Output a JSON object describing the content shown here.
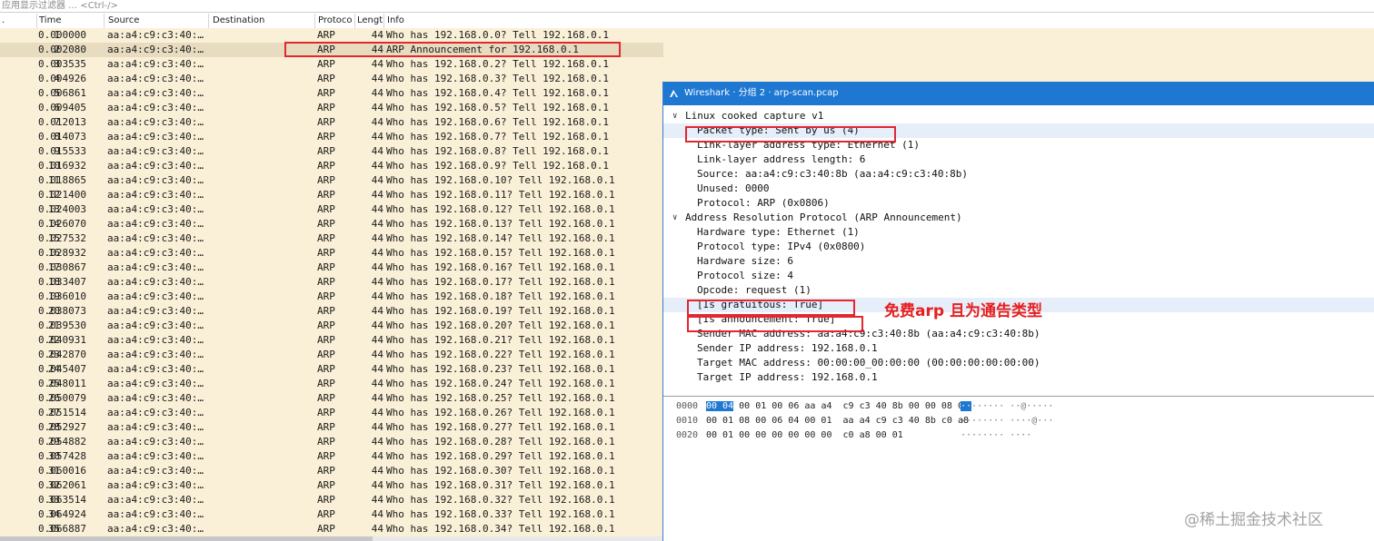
{
  "filter": {
    "placeholder": "应用显示过滤器 … <Ctrl-/>"
  },
  "columns": {
    "no": ".",
    "time": "Time",
    "source": "Source",
    "destination": "Destination",
    "protocol": "Protoco",
    "length": "Lengt",
    "info": "Info"
  },
  "packets": [
    {
      "no": "1",
      "time": "0.000000",
      "src": "aa:a4:c9:c3:40:…",
      "proto": "ARP",
      "len": "44",
      "info": "Who has 192.168.0.0? Tell 192.168.0.1"
    },
    {
      "no": "2",
      "time": "0.002080",
      "src": "aa:a4:c9:c3:40:…",
      "proto": "ARP",
      "len": "44",
      "info": "ARP Announcement for 192.168.0.1"
    },
    {
      "no": "3",
      "time": "0.003535",
      "src": "aa:a4:c9:c3:40:…",
      "proto": "ARP",
      "len": "44",
      "info": "Who has 192.168.0.2? Tell 192.168.0.1"
    },
    {
      "no": "4",
      "time": "0.004926",
      "src": "aa:a4:c9:c3:40:…",
      "proto": "ARP",
      "len": "44",
      "info": "Who has 192.168.0.3? Tell 192.168.0.1"
    },
    {
      "no": "5",
      "time": "0.006861",
      "src": "aa:a4:c9:c3:40:…",
      "proto": "ARP",
      "len": "44",
      "info": "Who has 192.168.0.4? Tell 192.168.0.1"
    },
    {
      "no": "6",
      "time": "0.009405",
      "src": "aa:a4:c9:c3:40:…",
      "proto": "ARP",
      "len": "44",
      "info": "Who has 192.168.0.5? Tell 192.168.0.1"
    },
    {
      "no": "7",
      "time": "0.012013",
      "src": "aa:a4:c9:c3:40:…",
      "proto": "ARP",
      "len": "44",
      "info": "Who has 192.168.0.6? Tell 192.168.0.1"
    },
    {
      "no": "8",
      "time": "0.014073",
      "src": "aa:a4:c9:c3:40:…",
      "proto": "ARP",
      "len": "44",
      "info": "Who has 192.168.0.7? Tell 192.168.0.1"
    },
    {
      "no": "9",
      "time": "0.015533",
      "src": "aa:a4:c9:c3:40:…",
      "proto": "ARP",
      "len": "44",
      "info": "Who has 192.168.0.8? Tell 192.168.0.1"
    },
    {
      "no": "10",
      "time": "0.016932",
      "src": "aa:a4:c9:c3:40:…",
      "proto": "ARP",
      "len": "44",
      "info": "Who has 192.168.0.9? Tell 192.168.0.1"
    },
    {
      "no": "11",
      "time": "0.018865",
      "src": "aa:a4:c9:c3:40:…",
      "proto": "ARP",
      "len": "44",
      "info": "Who has 192.168.0.10? Tell 192.168.0.1"
    },
    {
      "no": "12",
      "time": "0.021400",
      "src": "aa:a4:c9:c3:40:…",
      "proto": "ARP",
      "len": "44",
      "info": "Who has 192.168.0.11? Tell 192.168.0.1"
    },
    {
      "no": "13",
      "time": "0.024003",
      "src": "aa:a4:c9:c3:40:…",
      "proto": "ARP",
      "len": "44",
      "info": "Who has 192.168.0.12? Tell 192.168.0.1"
    },
    {
      "no": "14",
      "time": "0.026070",
      "src": "aa:a4:c9:c3:40:…",
      "proto": "ARP",
      "len": "44",
      "info": "Who has 192.168.0.13? Tell 192.168.0.1"
    },
    {
      "no": "15",
      "time": "0.027532",
      "src": "aa:a4:c9:c3:40:…",
      "proto": "ARP",
      "len": "44",
      "info": "Who has 192.168.0.14? Tell 192.168.0.1"
    },
    {
      "no": "16",
      "time": "0.028932",
      "src": "aa:a4:c9:c3:40:…",
      "proto": "ARP",
      "len": "44",
      "info": "Who has 192.168.0.15? Tell 192.168.0.1"
    },
    {
      "no": "17",
      "time": "0.030867",
      "src": "aa:a4:c9:c3:40:…",
      "proto": "ARP",
      "len": "44",
      "info": "Who has 192.168.0.16? Tell 192.168.0.1"
    },
    {
      "no": "18",
      "time": "0.033407",
      "src": "aa:a4:c9:c3:40:…",
      "proto": "ARP",
      "len": "44",
      "info": "Who has 192.168.0.17? Tell 192.168.0.1"
    },
    {
      "no": "19",
      "time": "0.036010",
      "src": "aa:a4:c9:c3:40:…",
      "proto": "ARP",
      "len": "44",
      "info": "Who has 192.168.0.18? Tell 192.168.0.1"
    },
    {
      "no": "20",
      "time": "0.038073",
      "src": "aa:a4:c9:c3:40:…",
      "proto": "ARP",
      "len": "44",
      "info": "Who has 192.168.0.19? Tell 192.168.0.1"
    },
    {
      "no": "21",
      "time": "0.039530",
      "src": "aa:a4:c9:c3:40:…",
      "proto": "ARP",
      "len": "44",
      "info": "Who has 192.168.0.20? Tell 192.168.0.1"
    },
    {
      "no": "22",
      "time": "0.040931",
      "src": "aa:a4:c9:c3:40:…",
      "proto": "ARP",
      "len": "44",
      "info": "Who has 192.168.0.21? Tell 192.168.0.1"
    },
    {
      "no": "23",
      "time": "0.042870",
      "src": "aa:a4:c9:c3:40:…",
      "proto": "ARP",
      "len": "44",
      "info": "Who has 192.168.0.22? Tell 192.168.0.1"
    },
    {
      "no": "24",
      "time": "0.045407",
      "src": "aa:a4:c9:c3:40:…",
      "proto": "ARP",
      "len": "44",
      "info": "Who has 192.168.0.23? Tell 192.168.0.1"
    },
    {
      "no": "25",
      "time": "0.048011",
      "src": "aa:a4:c9:c3:40:…",
      "proto": "ARP",
      "len": "44",
      "info": "Who has 192.168.0.24? Tell 192.168.0.1"
    },
    {
      "no": "26",
      "time": "0.050079",
      "src": "aa:a4:c9:c3:40:…",
      "proto": "ARP",
      "len": "44",
      "info": "Who has 192.168.0.25? Tell 192.168.0.1"
    },
    {
      "no": "27",
      "time": "0.051514",
      "src": "aa:a4:c9:c3:40:…",
      "proto": "ARP",
      "len": "44",
      "info": "Who has 192.168.0.26? Tell 192.168.0.1"
    },
    {
      "no": "28",
      "time": "0.052927",
      "src": "aa:a4:c9:c3:40:…",
      "proto": "ARP",
      "len": "44",
      "info": "Who has 192.168.0.27? Tell 192.168.0.1"
    },
    {
      "no": "29",
      "time": "0.054882",
      "src": "aa:a4:c9:c3:40:…",
      "proto": "ARP",
      "len": "44",
      "info": "Who has 192.168.0.28? Tell 192.168.0.1"
    },
    {
      "no": "30",
      "time": "0.057428",
      "src": "aa:a4:c9:c3:40:…",
      "proto": "ARP",
      "len": "44",
      "info": "Who has 192.168.0.29? Tell 192.168.0.1"
    },
    {
      "no": "31",
      "time": "0.060016",
      "src": "aa:a4:c9:c3:40:…",
      "proto": "ARP",
      "len": "44",
      "info": "Who has 192.168.0.30? Tell 192.168.0.1"
    },
    {
      "no": "32",
      "time": "0.062061",
      "src": "aa:a4:c9:c3:40:…",
      "proto": "ARP",
      "len": "44",
      "info": "Who has 192.168.0.31? Tell 192.168.0.1"
    },
    {
      "no": "33",
      "time": "0.063514",
      "src": "aa:a4:c9:c3:40:…",
      "proto": "ARP",
      "len": "44",
      "info": "Who has 192.168.0.32? Tell 192.168.0.1"
    },
    {
      "no": "34",
      "time": "0.064924",
      "src": "aa:a4:c9:c3:40:…",
      "proto": "ARP",
      "len": "44",
      "info": "Who has 192.168.0.33? Tell 192.168.0.1"
    },
    {
      "no": "35",
      "time": "0.066887",
      "src": "aa:a4:c9:c3:40:…",
      "proto": "ARP",
      "len": "44",
      "info": "Who has 192.168.0.34? Tell 192.168.0.1"
    }
  ],
  "detail_window": {
    "title": "Wireshark · 分组 2 · arp-scan.pcap",
    "tree": [
      {
        "level": 0,
        "text": "Linux cooked capture v1",
        "expanded": true
      },
      {
        "level": 1,
        "text": "Packet type: Sent by us (4)",
        "highlight": true
      },
      {
        "level": 1,
        "text": "Link-layer address type: Ethernet (1)"
      },
      {
        "level": 1,
        "text": "Link-layer address length: 6"
      },
      {
        "level": 1,
        "text": "Source: aa:a4:c9:c3:40:8b (aa:a4:c9:c3:40:8b)"
      },
      {
        "level": 1,
        "text": "Unused: 0000"
      },
      {
        "level": 1,
        "text": "Protocol: ARP (0x0806)"
      },
      {
        "level": 0,
        "text": "Address Resolution Protocol (ARP Announcement)",
        "expanded": true
      },
      {
        "level": 1,
        "text": "Hardware type: Ethernet (1)"
      },
      {
        "level": 1,
        "text": "Protocol type: IPv4 (0x0800)"
      },
      {
        "level": 1,
        "text": "Hardware size: 6"
      },
      {
        "level": 1,
        "text": "Protocol size: 4"
      },
      {
        "level": 1,
        "text": "Opcode: request (1)"
      },
      {
        "level": 1,
        "text": "[Is gratuitous: True]",
        "highlight": true
      },
      {
        "level": 1,
        "text": "[Is announcement: True]"
      },
      {
        "level": 1,
        "text": "Sender MAC address: aa:a4:c9:c3:40:8b (aa:a4:c9:c3:40:8b)"
      },
      {
        "level": 1,
        "text": "Sender IP address: 192.168.0.1"
      },
      {
        "level": 1,
        "text": "Target MAC address: 00:00:00_00:00:00 (00:00:00:00:00:00)"
      },
      {
        "level": 1,
        "text": "Target IP address: 192.168.0.1"
      }
    ],
    "annotation": "免费arp  且为通告类型",
    "hex": [
      {
        "offset": "0000",
        "sel": "00 04",
        "bytes": " 00 01 00 06 aa a4  c9 c3 40 8b 00 00 08 06",
        "ascii_sel": "··",
        "ascii": "······ ··@·····"
      },
      {
        "offset": "0010",
        "sel": "",
        "bytes": "00 01 08 00 06 04 00 01  aa a4 c9 c3 40 8b c0 a8",
        "ascii_sel": "",
        "ascii": "········ ····@···"
      },
      {
        "offset": "0020",
        "sel": "",
        "bytes": "00 01 00 00 00 00 00 00  c0 a8 00 01",
        "ascii_sel": "",
        "ascii": "········ ····"
      }
    ]
  },
  "watermark": "@稀土掘金技术社区",
  "colors": {
    "row_bg": "#faf0d7",
    "selected_row": "#e8dcc0",
    "title_bar": "#1e78d2",
    "annotation_red": "#e61e1e"
  }
}
